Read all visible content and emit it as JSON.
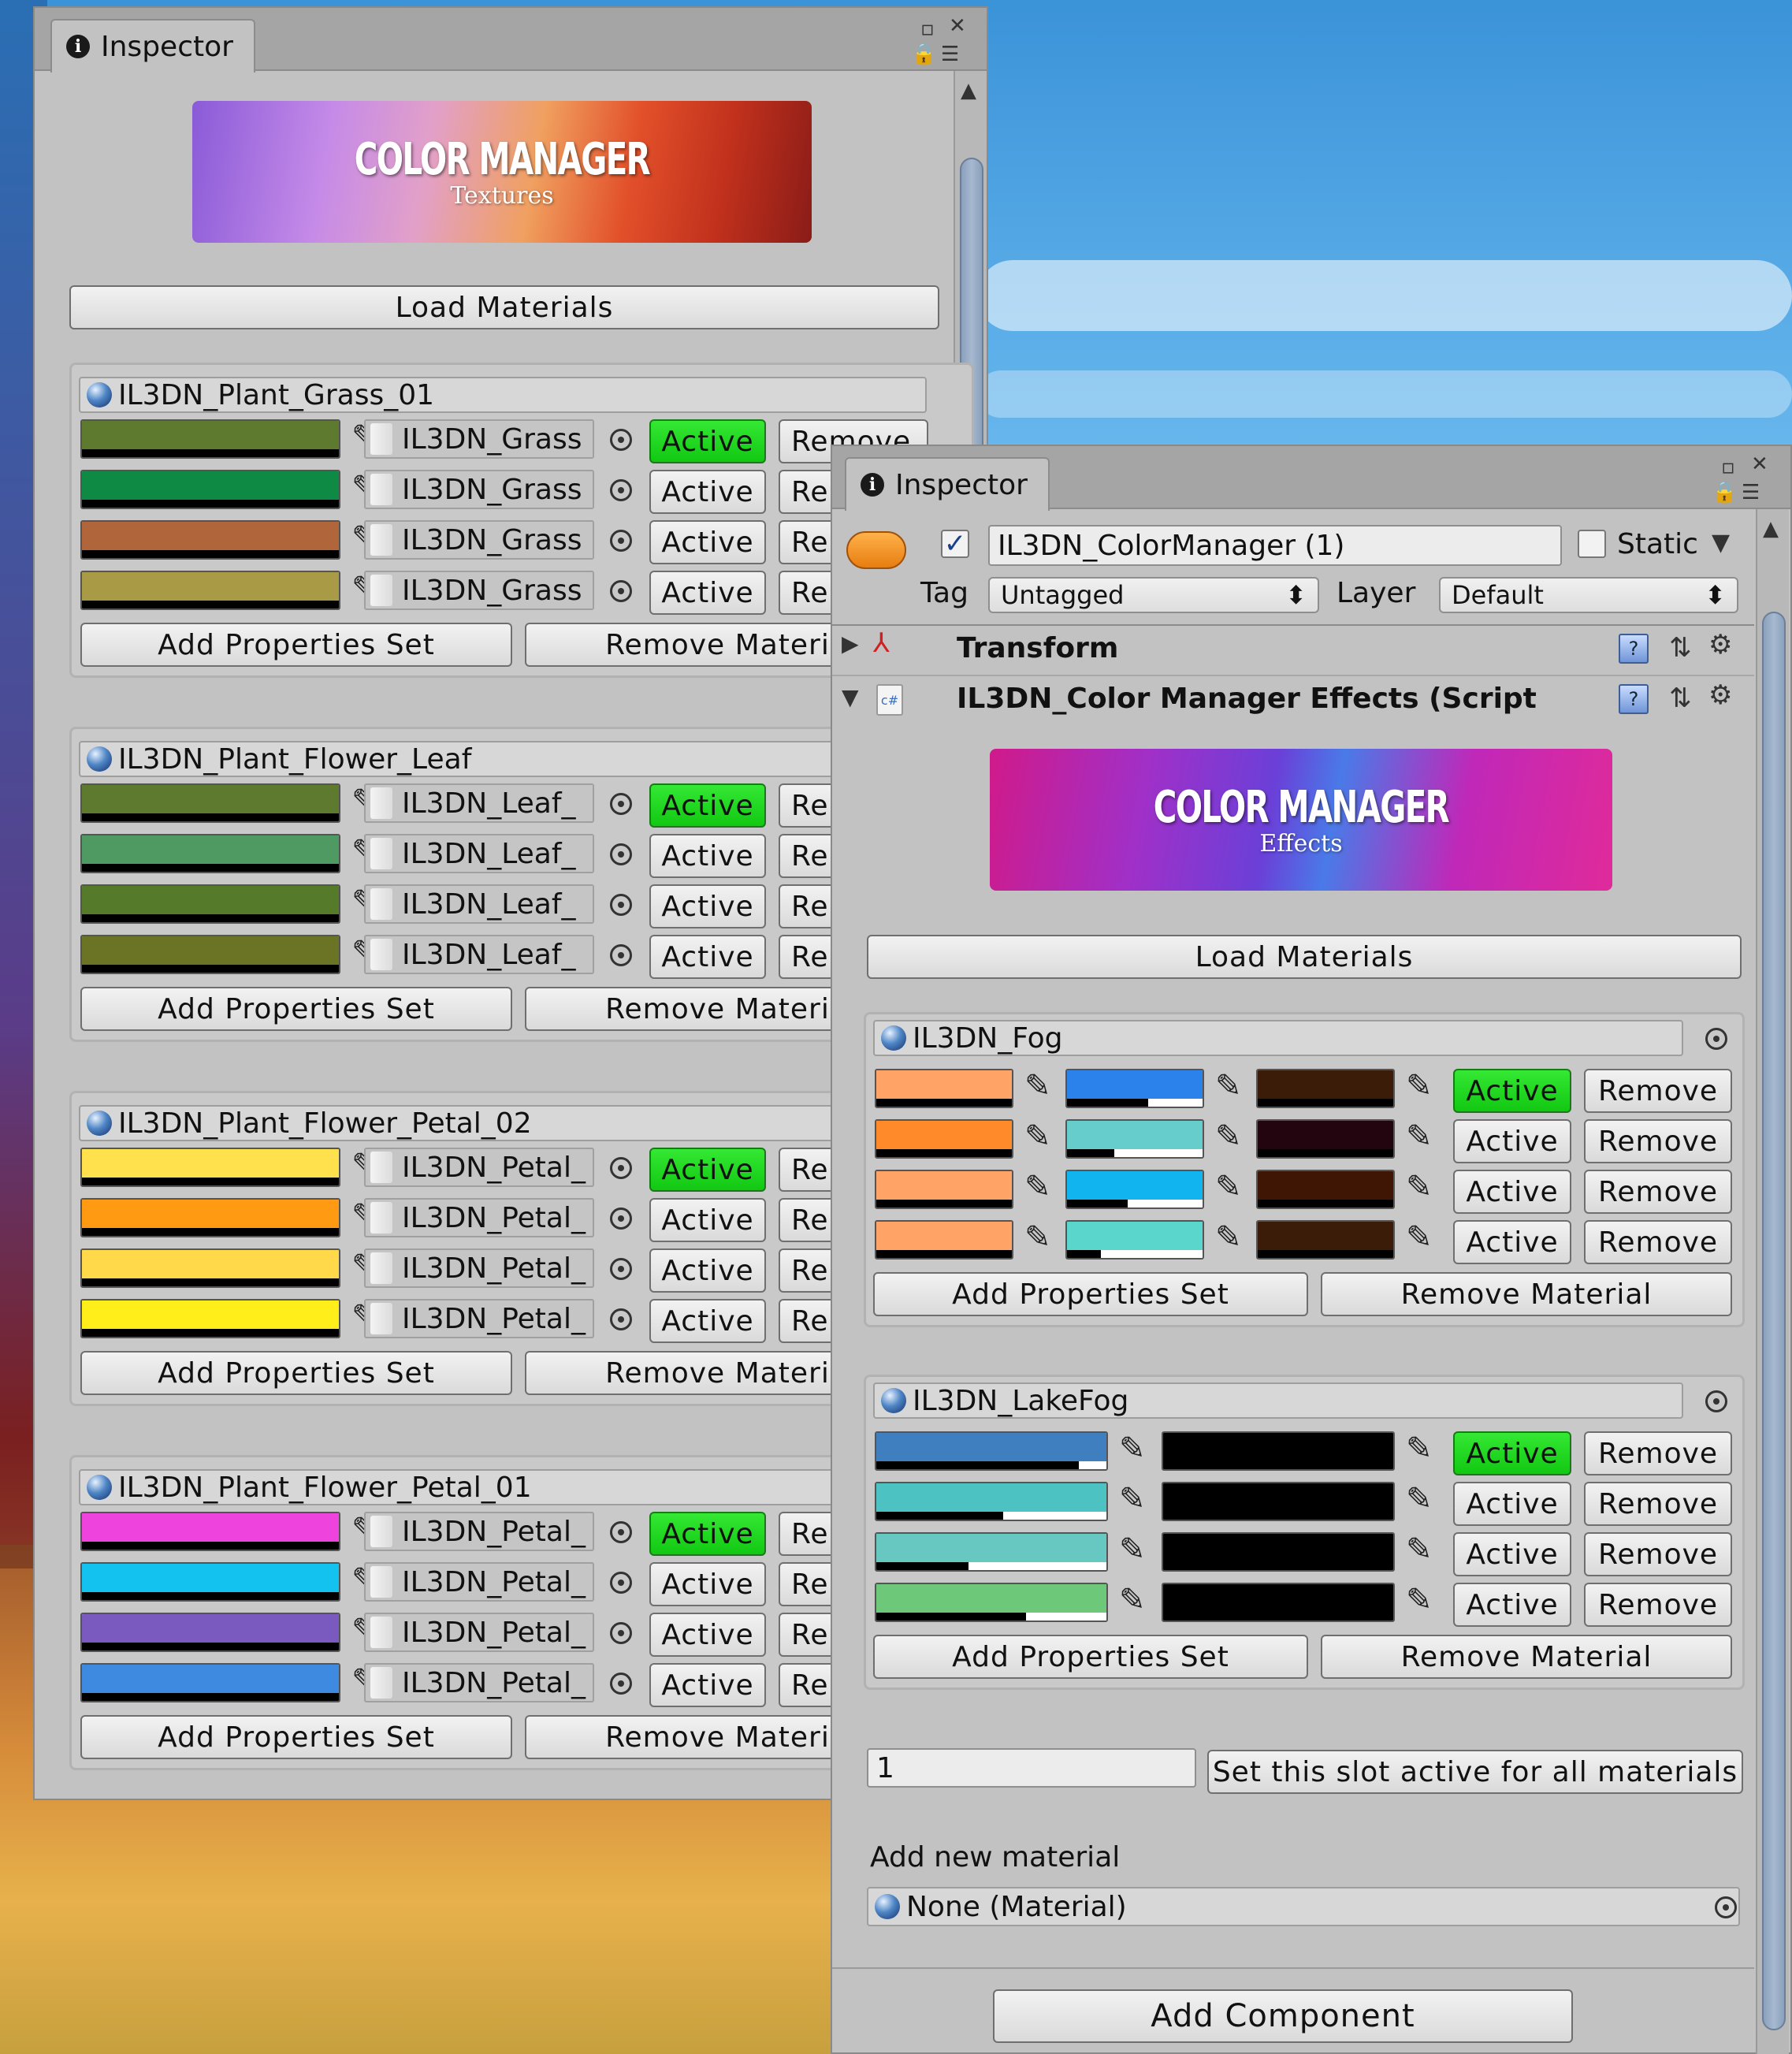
{
  "left_inspector": {
    "tab_label": "Inspector",
    "banner": {
      "title": "COLOR MANAGER",
      "subtitle": "Textures"
    },
    "load_materials": "Load Materials",
    "groups": [
      {
        "name": "IL3DN_Plant_Grass_01",
        "rows": [
          {
            "color": "#5d7a2e",
            "alpha": 1.0,
            "texture": "IL3DN_Grass",
            "active": true,
            "remove": "Remove"
          },
          {
            "color": "#0f8a45",
            "alpha": 1.0,
            "texture": "IL3DN_Grass",
            "active": false,
            "remove": "Re"
          },
          {
            "color": "#b0663a",
            "alpha": 1.0,
            "texture": "IL3DN_Grass",
            "active": false,
            "remove": "Re"
          },
          {
            "color": "#a99a45",
            "alpha": 1.0,
            "texture": "IL3DN_Grass",
            "active": false,
            "remove": "Re"
          }
        ],
        "add": "Add Properties Set",
        "remove_material": "Remove Materia"
      },
      {
        "name": "IL3DN_Plant_Flower_Leaf",
        "rows": [
          {
            "color": "#5d7a2e",
            "alpha": 1.0,
            "texture": "IL3DN_Leaf_",
            "active": true,
            "remove": "Re"
          },
          {
            "color": "#4f9a62",
            "alpha": 1.0,
            "texture": "IL3DN_Leaf_",
            "active": false,
            "remove": "Re"
          },
          {
            "color": "#557a2a",
            "alpha": 1.0,
            "texture": "IL3DN_Leaf_",
            "active": false,
            "remove": "Re"
          },
          {
            "color": "#6a7424",
            "alpha": 1.0,
            "texture": "IL3DN_Leaf_",
            "active": false,
            "remove": "Re"
          }
        ],
        "add": "Add Properties Set",
        "remove_material": "Remove Materia"
      },
      {
        "name": "IL3DN_Plant_Flower_Petal_02",
        "rows": [
          {
            "color": "#ffe14d",
            "alpha": 1.0,
            "texture": "IL3DN_Petal_",
            "active": true,
            "remove": "Re"
          },
          {
            "color": "#ff9a12",
            "alpha": 1.0,
            "texture": "IL3DN_Petal_",
            "active": false,
            "remove": "Re"
          },
          {
            "color": "#ffd94a",
            "alpha": 1.0,
            "texture": "IL3DN_Petal_",
            "active": false,
            "remove": "Re"
          },
          {
            "color": "#ffee1a",
            "alpha": 1.0,
            "texture": "IL3DN_Petal_",
            "active": false,
            "remove": "Re"
          }
        ],
        "add": "Add Properties Set",
        "remove_material": "Remove Materia"
      },
      {
        "name": "IL3DN_Plant_Flower_Petal_01",
        "rows": [
          {
            "color": "#ee44dd",
            "alpha": 1.0,
            "texture": "IL3DN_Petal_",
            "active": true,
            "remove": "Re"
          },
          {
            "color": "#14c2f0",
            "alpha": 1.0,
            "texture": "IL3DN_Petal_",
            "active": false,
            "remove": "Re"
          },
          {
            "color": "#7a5abf",
            "alpha": 1.0,
            "texture": "IL3DN_Petal_",
            "active": false,
            "remove": "Re"
          },
          {
            "color": "#3d8ae0",
            "alpha": 1.0,
            "texture": "IL3DN_Petal_",
            "active": false,
            "remove": "Re"
          }
        ],
        "add": "Add Properties Set",
        "remove_material": "Remove Materia"
      }
    ]
  },
  "right_inspector": {
    "tab_label": "Inspector",
    "object_name": "IL3DN_ColorManager (1)",
    "static_label": "Static",
    "tag_label": "Tag",
    "tag_value": "Untagged",
    "layer_label": "Layer",
    "layer_value": "Default",
    "transform_label": "Transform",
    "script_label": "IL3DN_Color Manager Effects (Script",
    "banner": {
      "title": "COLOR MANAGER",
      "subtitle": "Effects"
    },
    "load_materials": "Load Materials",
    "fog": {
      "name": "IL3DN_Fog",
      "rows": [
        {
          "colors": [
            "#ffa366",
            "#2b82ea",
            "#3a1c08"
          ],
          "alphas": [
            1.0,
            0.6,
            1.0
          ],
          "active": true
        },
        {
          "colors": [
            "#ff8a2a",
            "#66cccc",
            "#230510"
          ],
          "alphas": [
            1.0,
            0.35,
            1.0
          ],
          "active": false
        },
        {
          "colors": [
            "#ffa366",
            "#12b4f0",
            "#3f1604"
          ],
          "alphas": [
            1.0,
            0.45,
            1.0
          ],
          "active": false
        },
        {
          "colors": [
            "#ffa366",
            "#5ad6cc",
            "#3a1c08"
          ],
          "alphas": [
            1.0,
            0.25,
            1.0
          ],
          "active": false
        }
      ],
      "remove": "Remove",
      "add": "Add Properties Set",
      "remove_material": "Remove Material"
    },
    "lakefog": {
      "name": "IL3DN_LakeFog",
      "rows": [
        {
          "colors": [
            "#3f7fc0",
            "#000000"
          ],
          "alphas": [
            0.88,
            1.0
          ],
          "active": true
        },
        {
          "colors": [
            "#4cc2c2",
            "#000000"
          ],
          "alphas": [
            0.55,
            1.0
          ],
          "active": false
        },
        {
          "colors": [
            "#66c8c0",
            "#000000"
          ],
          "alphas": [
            0.4,
            1.0
          ],
          "active": false
        },
        {
          "colors": [
            "#6ec87a",
            "#000000"
          ],
          "alphas": [
            0.65,
            1.0
          ],
          "active": false
        }
      ],
      "remove": "Remove",
      "add": "Add Properties Set",
      "remove_material": "Remove Material"
    },
    "slot_value": "1",
    "set_slot_button": "Set this slot active for all materials",
    "add_new_material_label": "Add new material",
    "material_field": "None (Material)",
    "add_component": "Add Component"
  },
  "labels": {
    "active": "Active"
  }
}
